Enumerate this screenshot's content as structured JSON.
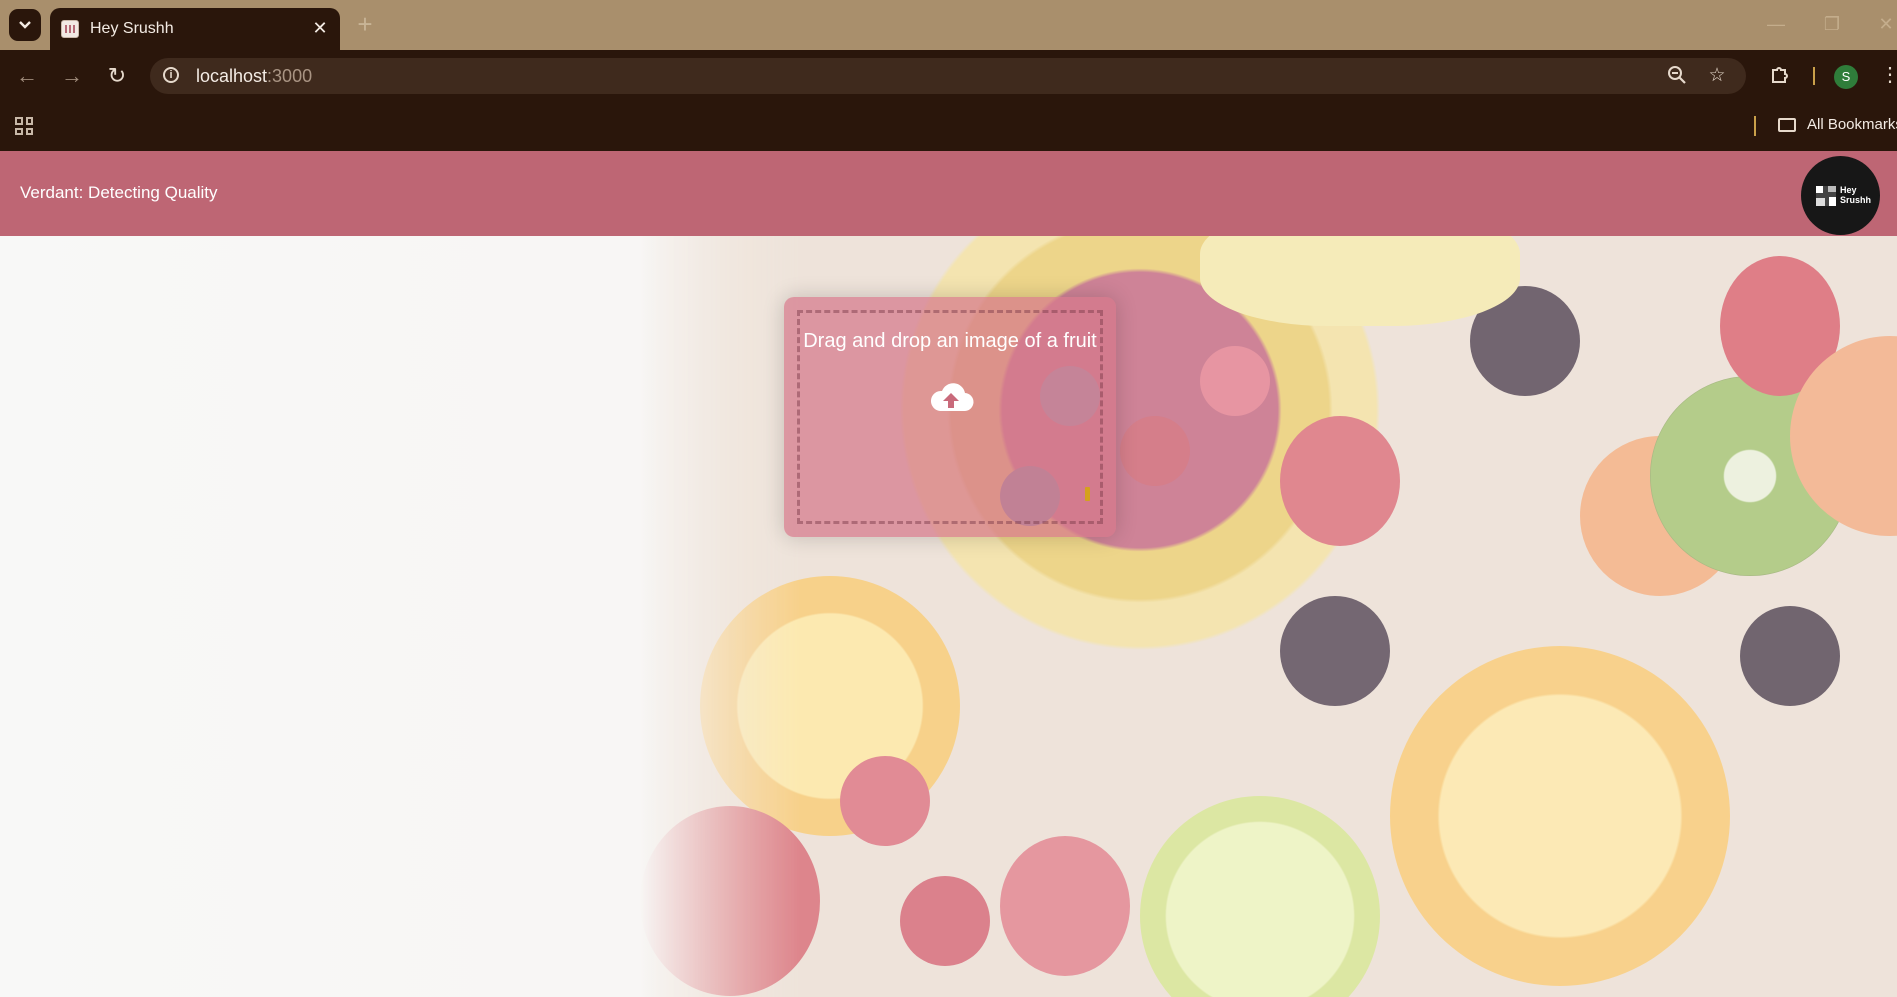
{
  "browser": {
    "tab": {
      "title": "Hey Srushh"
    },
    "address": {
      "host": "localhost",
      "port": ":3000"
    },
    "profile_initial": "S",
    "bookmarks_label": "All Bookmarks"
  },
  "app": {
    "title": "Verdant: Detecting Quality",
    "avatar_text_line1": "Hey",
    "avatar_text_line2": "Srushh"
  },
  "dropzone": {
    "label": "Drag and drop an image of a fruit",
    "icon": "cloud-upload-icon"
  },
  "colors": {
    "header": "#be6674",
    "dropzone": "#d6788a",
    "browser_dark": "#2a160b",
    "tabstrip": "#a98f6c"
  }
}
